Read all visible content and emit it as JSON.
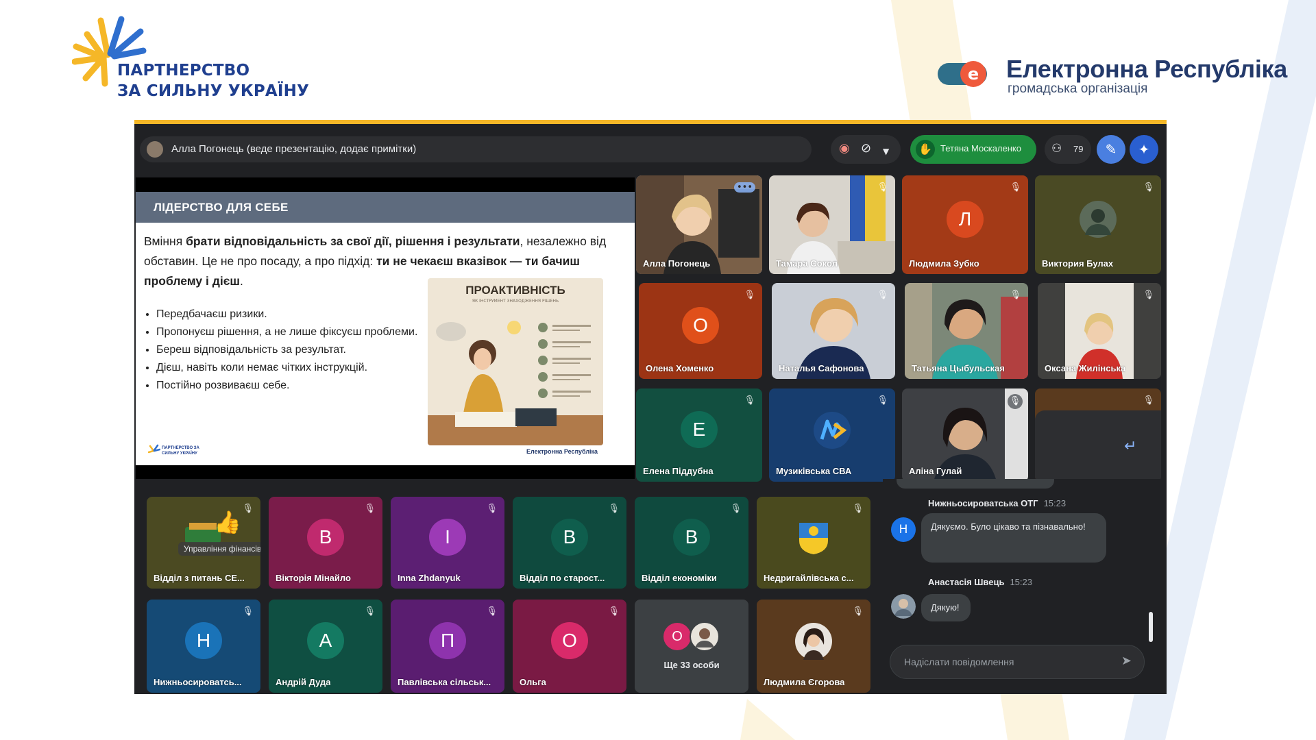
{
  "header": {
    "left_logo": {
      "line1": "ПАРТНЕРСТВО",
      "line2": "ЗА СИЛЬНУ УКРАЇНУ"
    },
    "right_logo": {
      "name": "Електронна Республіка",
      "subtitle": "громадська організація",
      "badge_letter": "e"
    }
  },
  "colors": {
    "accent_yellow": "#f5b728",
    "accent_blue": "#1f3f8f",
    "meet_bg": "#202124",
    "hand_green": "#1e8e3e"
  },
  "meeting": {
    "presenter_bar": "Алла Погонець (веде презентацію, додає примітки)",
    "raised_hand_name": "Тетяна Москаленко",
    "participant_count": "79",
    "icons": [
      "record-icon",
      "camera-off-icon",
      "chevron-down-icon",
      "raised-hand-icon",
      "people-icon",
      "edit-icon",
      "sparkle-icon"
    ]
  },
  "slide": {
    "title": "ЛІДЕРСТВО ДЛЯ СЕБЕ",
    "para_t1": "Вміння ",
    "para_b1": "брати відповідальність за свої дії, рішення і результати",
    "para_t2": ", незалежно від обставин. Це не про посаду, а про підхід: ",
    "para_b2": "ти не чекаєш вказівок — ти бачиш проблему і дієш",
    "para_t3": ".",
    "bullets": [
      "Передбачаєш ризики.",
      "Пропонуєш рішення, а не лише фіксуєш проблеми.",
      "Береш відповідальність за результат.",
      "Дієш, навіть коли немає чітких інструкцій.",
      "Постійно розвиваєш себе."
    ],
    "infographic_title": "ПРОАКТИВНІСТЬ",
    "infographic_sub": "ЯК ІНСТРУМЕНТ ЗНАХОДЖЕННЯ РІШЕНЬ",
    "footer_left_logo": "ПАРТНЕРСТВО ЗА СИЛЬНУ УКРАЇНУ",
    "footer_right_logo": "Електронна Республіка"
  },
  "tiles_top": [
    {
      "name": "Алла Погонець",
      "type": "photo",
      "highlight": true
    },
    {
      "name": "Тамара Сокол",
      "type": "photo"
    },
    {
      "name": "Людмила Зубко",
      "letter": "Л",
      "bg": "#a33a17",
      "circle": "#d9491f"
    },
    {
      "name": "Виктория Булах",
      "type": "photo-small",
      "bg": "#4a4a24"
    },
    {
      "name": "Олена Хоменко",
      "letter": "О",
      "bg": "#9c3414",
      "circle": "#e0501a"
    },
    {
      "name": "Наталья Сафонова",
      "type": "photo"
    },
    {
      "name": "Татьяна Цыбульская",
      "type": "photo"
    },
    {
      "name": "Оксана Жилінська",
      "type": "photo"
    },
    {
      "name": "Елена Піддубна",
      "letter": "Е",
      "bg": "#124f40",
      "circle": "#0f6b55"
    },
    {
      "name": "Музиківська СВА",
      "type": "logo",
      "bg": "#173d6e"
    },
    {
      "name": "Аліна Гулай",
      "type": "photo"
    }
  ],
  "tiles_bottom": [
    {
      "name": "Відділ з питань СЕ...",
      "overlay": "Управління фінансів та е...",
      "type": "logo",
      "bg": "#4b4a22"
    },
    {
      "name": "Вікторія Мінайло",
      "letter": "В",
      "bg": "#7a1c4a",
      "circle": "#c02a6e"
    },
    {
      "name": "Inna Zhdanyuk",
      "letter": "І",
      "bg": "#5c1f73",
      "circle": "#9c3ab6"
    },
    {
      "name": "Відділ по старост...",
      "letter": "В",
      "bg": "#0f4a3e",
      "circle": "#0f5e4d"
    },
    {
      "name": "Відділ економіки",
      "letter": "В",
      "bg": "#0f4a3e",
      "circle": "#0f5e4d"
    },
    {
      "name": "Недригайлівська с...",
      "type": "logo",
      "bg": "#4a4a1e"
    },
    {
      "name": "Нижньосироватсь...",
      "letter": "Н",
      "bg": "#154a75",
      "circle": "#1a73b8"
    },
    {
      "name": "Андрій Дуда",
      "letter": "А",
      "bg": "#0f4f42",
      "circle": "#147a62"
    },
    {
      "name": "Павлівська сільськ...",
      "letter": "П",
      "bg": "#5a1d70",
      "circle": "#8e33ad"
    },
    {
      "name": "Ольга",
      "letter": "О",
      "bg": "#7a1a44",
      "circle": "#d92a6a"
    },
    {
      "name": "Ще 33 особи",
      "letter": "О",
      "bg": "#3c4043",
      "circle": "#d92a6a"
    },
    {
      "name": "Людмила Єгорова",
      "type": "photo-small",
      "bg": "#5a3a1e"
    }
  ],
  "chat": {
    "messages": [
      {
        "sender": "Нижньосироватська ОТГ",
        "time": "15:23",
        "text": "Дякуємо. Було цікаво та пізнавально!",
        "avatar": "Н"
      },
      {
        "sender": "Анастасія Швець",
        "time": "15:23",
        "text": "Дякую!"
      }
    ],
    "input_placeholder": "Надіслати повідомлення"
  }
}
